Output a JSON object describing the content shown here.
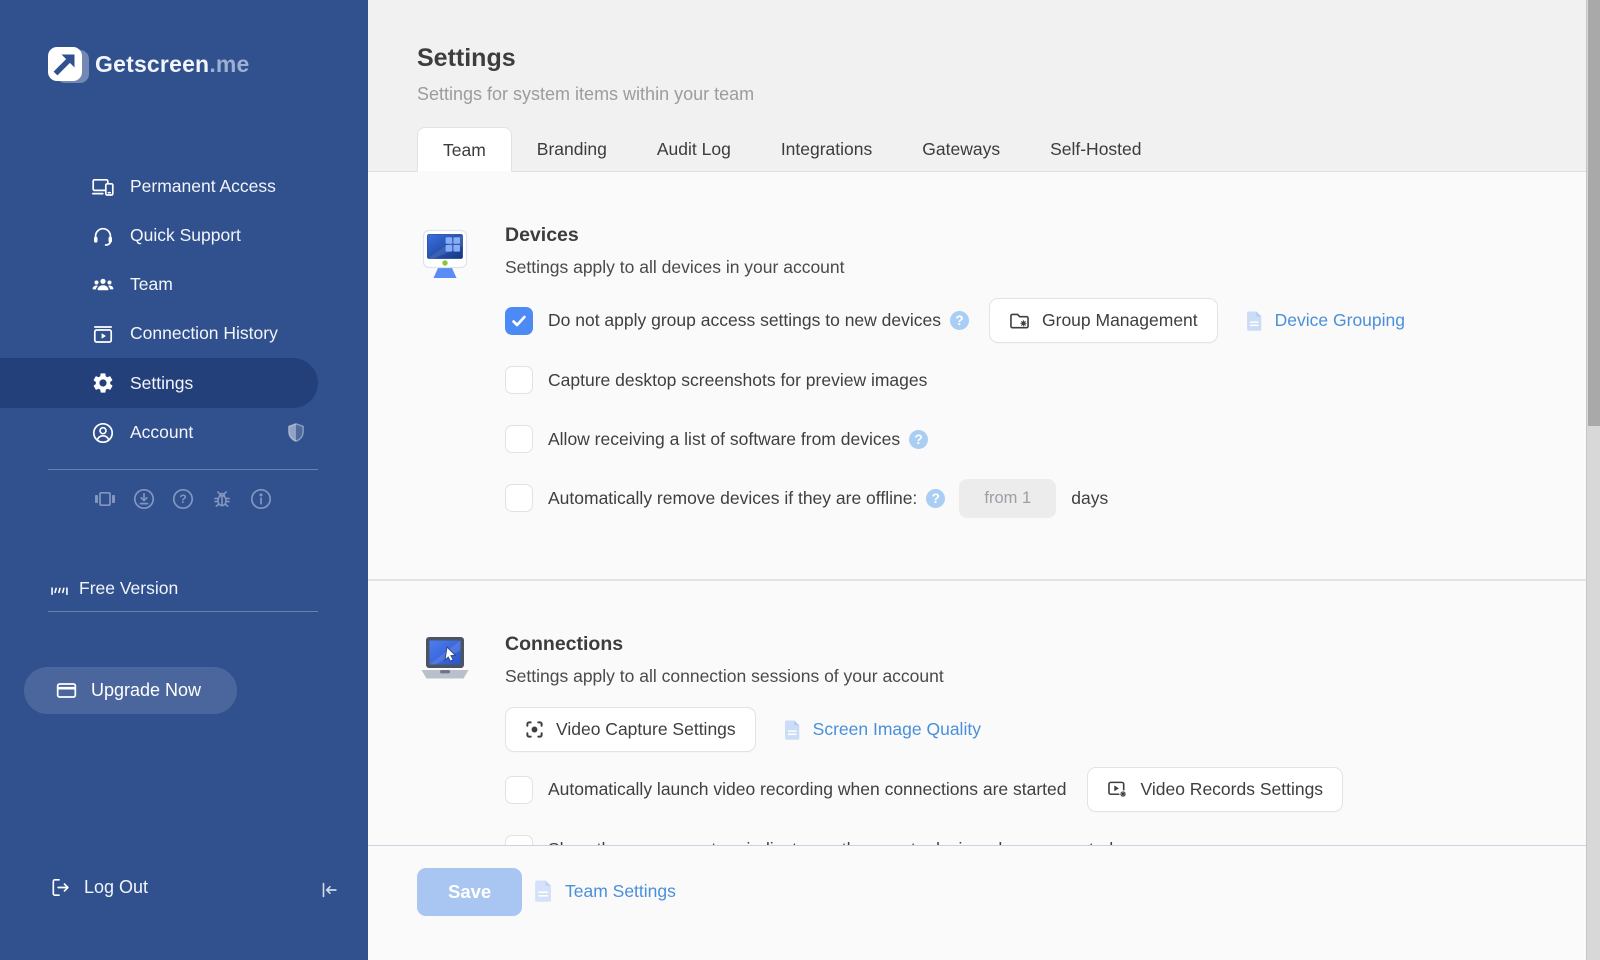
{
  "colors": {
    "sidebar_bg": "#31508e",
    "sidebar_active": "#24407a",
    "accent_blue": "#4c8bf5",
    "link_blue": "#4a90d9",
    "save_disabled": "#a9c6f3",
    "header_bg": "#f1f1f1",
    "content_bg": "#fafafa"
  },
  "glyphs": {
    "question": "?"
  },
  "sidebar": {
    "brand": "Getscreen",
    "brand_suffix": ".me",
    "items": [
      {
        "label": "Permanent Access",
        "icon": "laptop-phone-icon",
        "active": false
      },
      {
        "label": "Quick Support",
        "icon": "headset-icon",
        "active": false
      },
      {
        "label": "Team",
        "icon": "people-icon",
        "active": false
      },
      {
        "label": "Connection History",
        "icon": "history-play-icon",
        "active": false
      },
      {
        "label": "Settings",
        "icon": "gear-icon",
        "active": true
      },
      {
        "label": "Account",
        "icon": "user-circle-icon",
        "active": false,
        "badge": "shield-icon"
      }
    ],
    "utility_icons": [
      "versions-icon",
      "download-icon",
      "help-icon",
      "bug-icon",
      "info-icon"
    ],
    "plan_label": "Free Version",
    "upgrade_label": "Upgrade Now",
    "logout_label": "Log Out"
  },
  "header": {
    "title": "Settings",
    "subtitle": "Settings for system items within your team"
  },
  "tabs": {
    "items": [
      {
        "label": "Team",
        "active": true
      },
      {
        "label": "Branding",
        "active": false
      },
      {
        "label": "Audit Log",
        "active": false
      },
      {
        "label": "Integrations",
        "active": false
      },
      {
        "label": "Gateways",
        "active": false
      },
      {
        "label": "Self-Hosted",
        "active": false
      }
    ]
  },
  "devices": {
    "title": "Devices",
    "subtitle": "Settings apply to all devices in your account",
    "rows": [
      {
        "checked": true,
        "label": "Do not apply group access settings to new devices",
        "help": true,
        "button_label": "Group Management",
        "link_label": "Device Grouping"
      },
      {
        "checked": false,
        "label": "Capture desktop screenshots for preview images"
      },
      {
        "checked": false,
        "label": "Allow receiving a list of software from devices",
        "help": true
      },
      {
        "checked": false,
        "label": "Automatically remove devices if they are offline:",
        "help": true,
        "input_value": "from 1",
        "suffix": "days"
      }
    ]
  },
  "connections": {
    "title": "Connections",
    "subtitle": "Settings apply to all connection sessions of your account",
    "capture_button_label": "Video Capture Settings",
    "quality_link_label": "Screen Image Quality",
    "rows": [
      {
        "checked": false,
        "label": "Automatically launch video recording when connections are started",
        "button_label": "Video Records Settings"
      },
      {
        "checked": false,
        "label": "Show the screen capture indicator on the remote device when connected"
      }
    ]
  },
  "footer": {
    "save_label": "Save",
    "link_label": "Team Settings"
  }
}
